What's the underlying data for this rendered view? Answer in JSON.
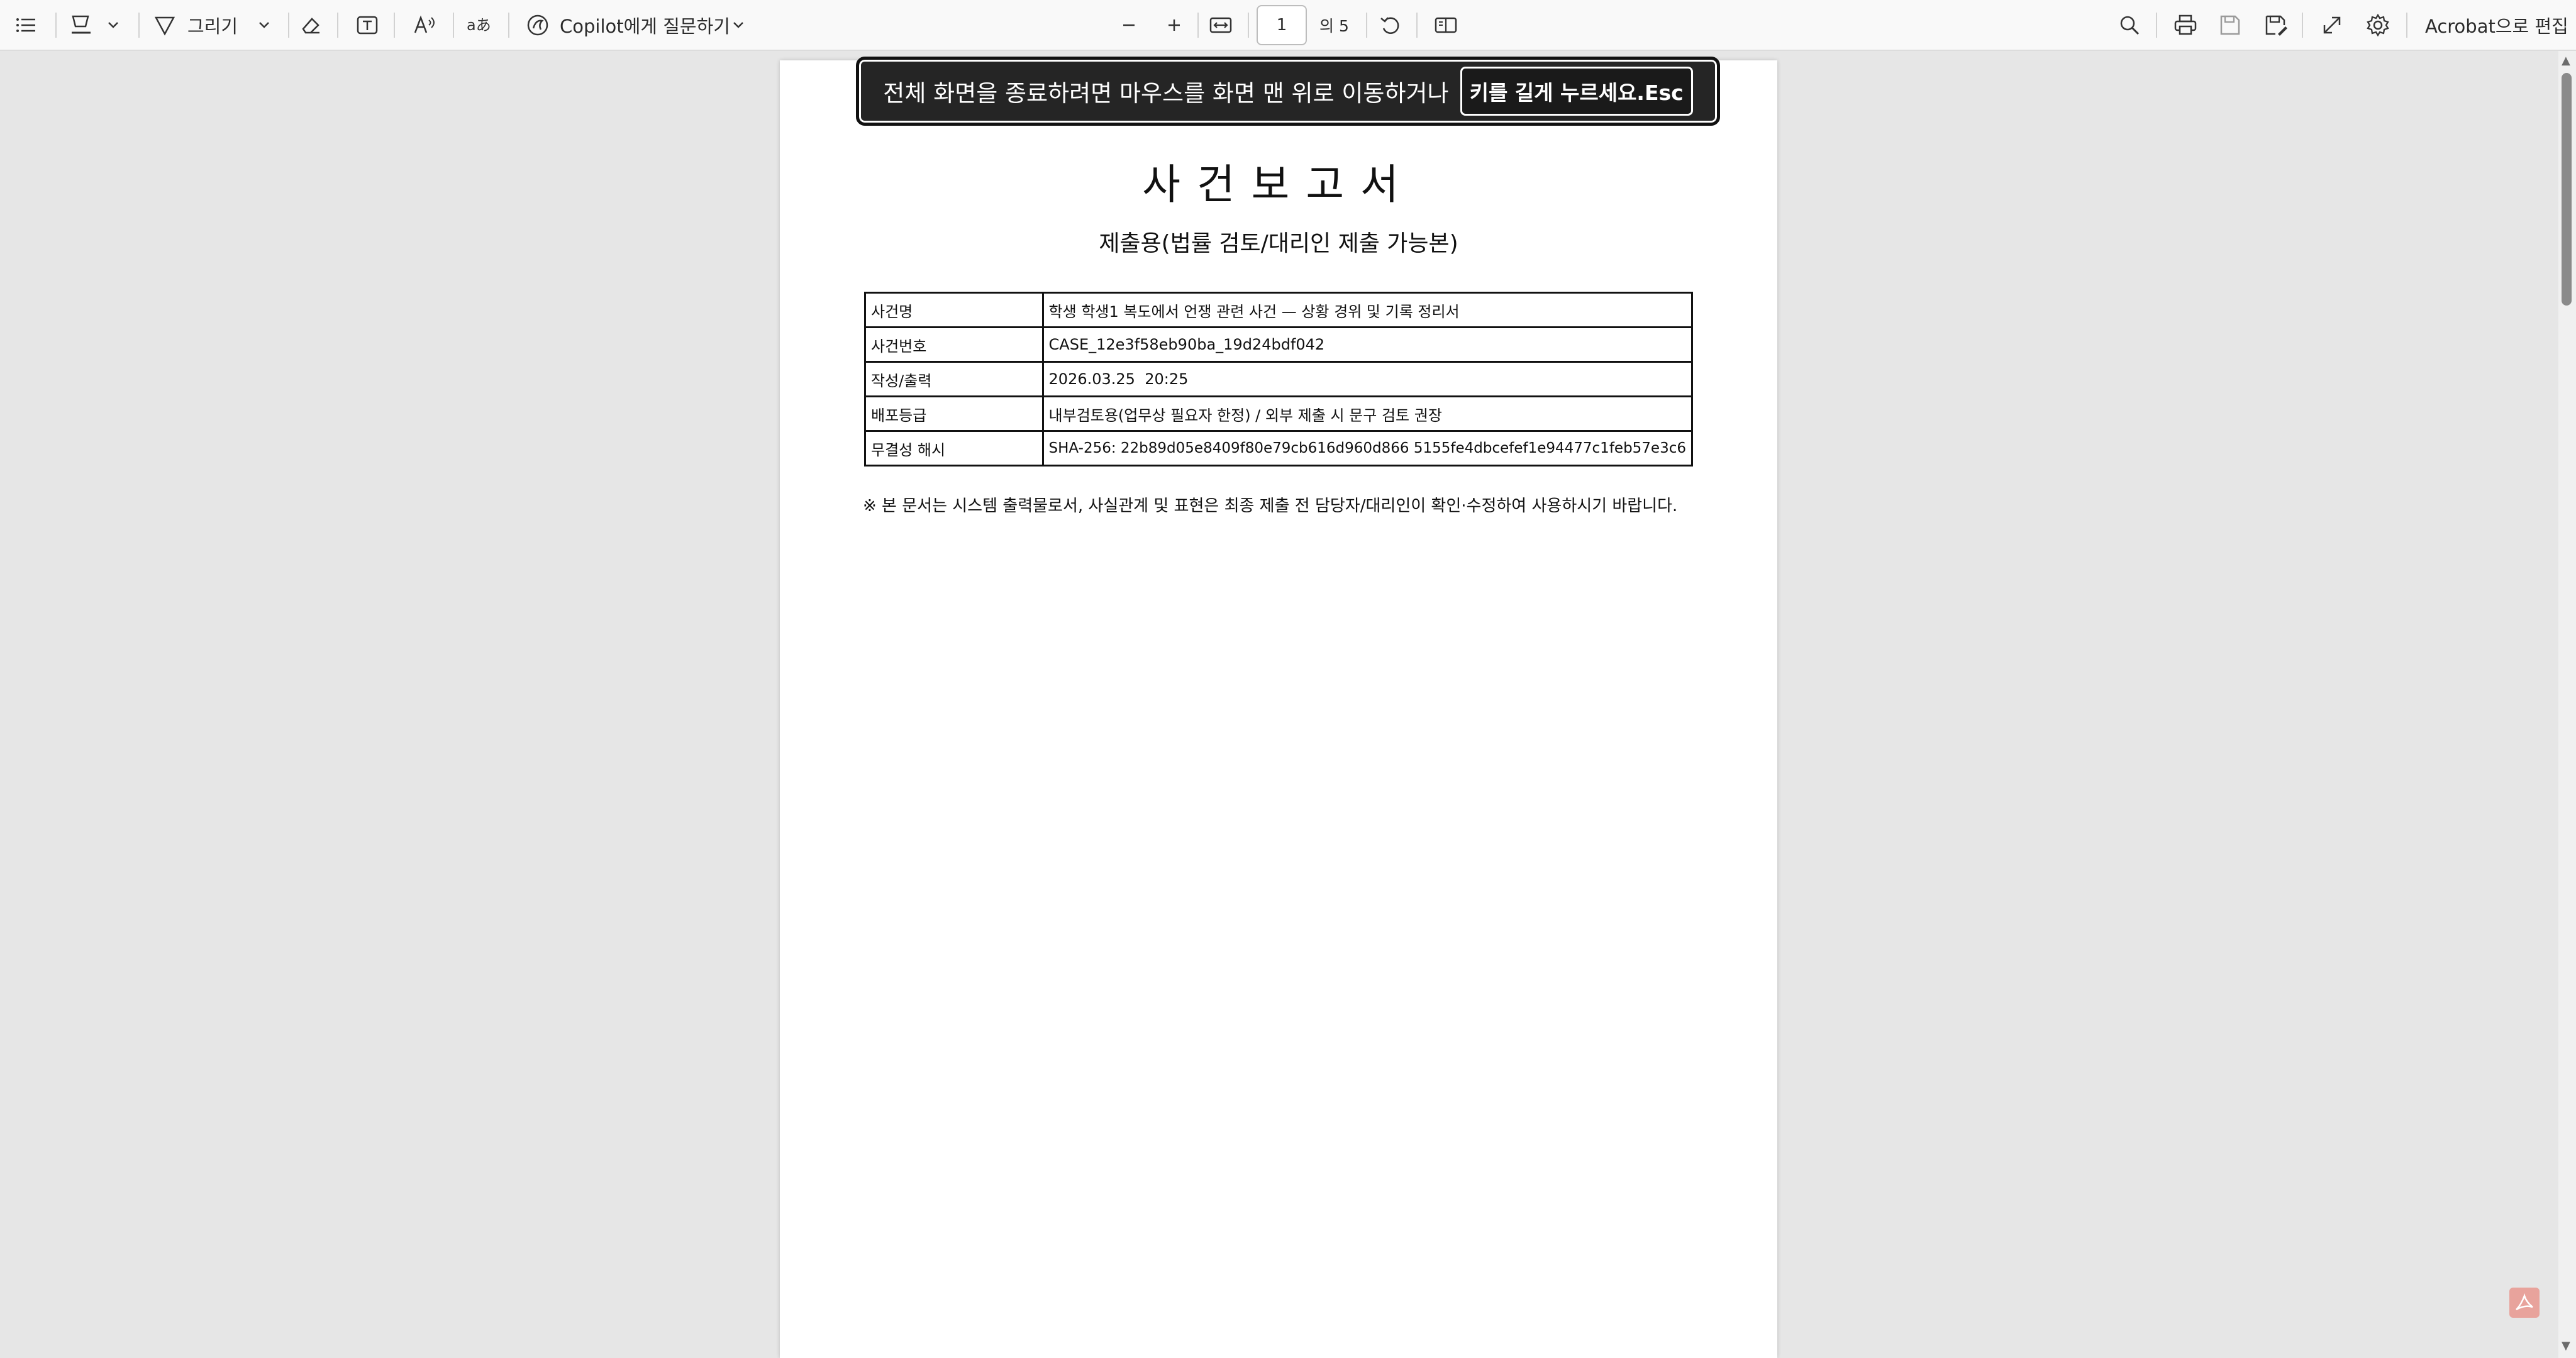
{
  "toolbar": {
    "draw_label": "그리기",
    "copilot_label": "Copilot에게 질문하기",
    "page_number": "1",
    "page_total": "의 5",
    "edit_in_acrobat": "Acrobat으로 편집"
  },
  "banner": {
    "text": "전체 화면을 종료하려면 마우스를 화면 맨 위로 이동하거나",
    "key_text": "키를 길게 누르세요.Esc"
  },
  "document": {
    "title": "사건보고서",
    "subtitle": "제출용(법률 검토/대리인 제출 가능본)",
    "rows": [
      {
        "key": "사건명",
        "value": "학생 학생1 복도에서 언쟁 관련 사건 — 상황 경위 및 기록 정리서"
      },
      {
        "key": "사건번호",
        "value": "CASE_12e3f58eb90ba_19d24bdf042"
      },
      {
        "key": "작성/출력",
        "value": "2026.03.25  20:25"
      },
      {
        "key": "배포등급",
        "value": "내부검토용(업무상 필요자 한정) / 외부 제출 시 문구 검토 권장"
      },
      {
        "key": "무결성 해시",
        "value": "SHA-256: 22b89d05e8409f80e79cb616d960d866 5155fe4dbcefef1e94477c1feb57e3c6"
      }
    ],
    "note": "※ 본 문서는 시스템 출력물로서, 사실관계 및 표현은 최종 제출 전 담당자/대리인이 확인·수정하여 사용하시기 바랍니다."
  },
  "colors": {
    "toolbar_bg": "#f9f9f9",
    "viewer_bg": "#e6e6e6",
    "banner_bg": "#252525",
    "acrobat_badge": "#e8a39c"
  }
}
